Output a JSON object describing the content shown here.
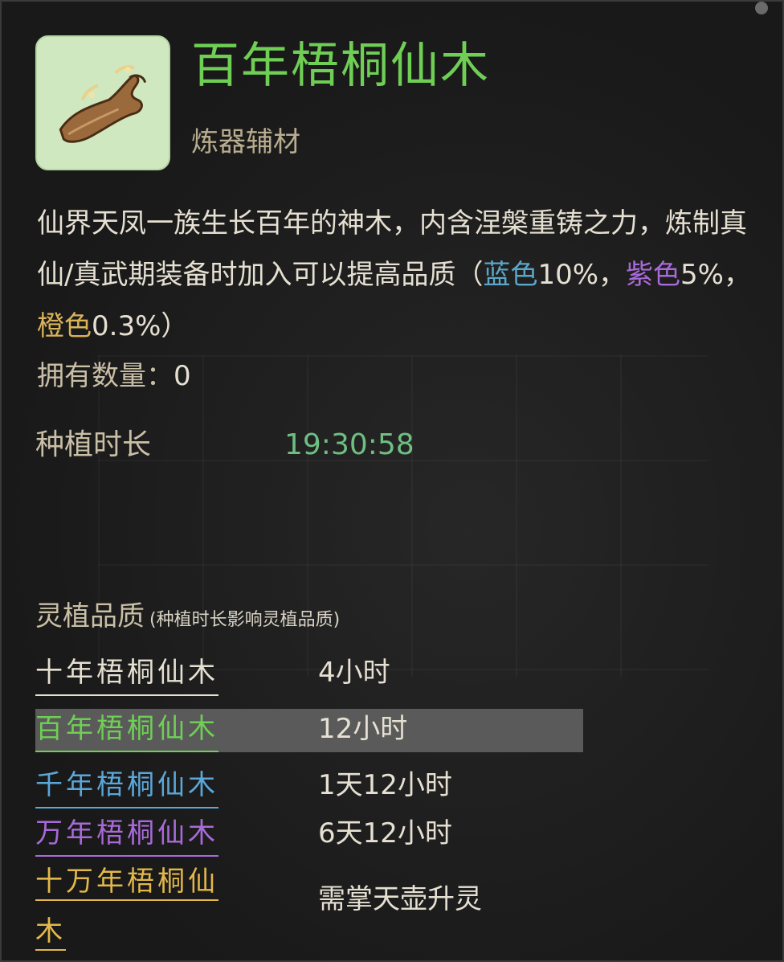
{
  "item": {
    "name": "百年梧桐仙木",
    "category": "炼器辅材",
    "icon": "wood-branch-icon"
  },
  "description": {
    "main": "仙界天凤一族生长百年的神木，内含涅槃重铸之力，炼制真仙/真武期装备时加入可以提高品质（",
    "blue_label": "蓝色",
    "blue_value": "10%，",
    "purple_label": "紫色",
    "purple_value": "5%，",
    "orange_label": "橙色",
    "orange_value": "0.3%）"
  },
  "owned": {
    "label": "拥有数量：",
    "value": "0"
  },
  "planting": {
    "label": "种植时长",
    "time": "19:30:58"
  },
  "quality": {
    "heading": "灵植品质",
    "note": "(种植时长影响灵植品质)",
    "tiers": [
      {
        "name": "十年梧桐仙木",
        "duration": "4小时"
      },
      {
        "name": "百年梧桐仙木",
        "duration": "12小时"
      },
      {
        "name": "千年梧桐仙木",
        "duration": "1天12小时"
      },
      {
        "name": "万年梧桐仙木",
        "duration": "6天12小时"
      },
      {
        "name_line1": "十万年梧桐仙",
        "name_line2": "木",
        "duration": "需掌天壶升灵"
      }
    ]
  },
  "colors": {
    "title": "#6fcf55",
    "blue": "#5aa7c9",
    "purple": "#a86ad8",
    "orange": "#d9b25a",
    "timer": "#6fbe82",
    "highlight": "#5a5a5a"
  }
}
